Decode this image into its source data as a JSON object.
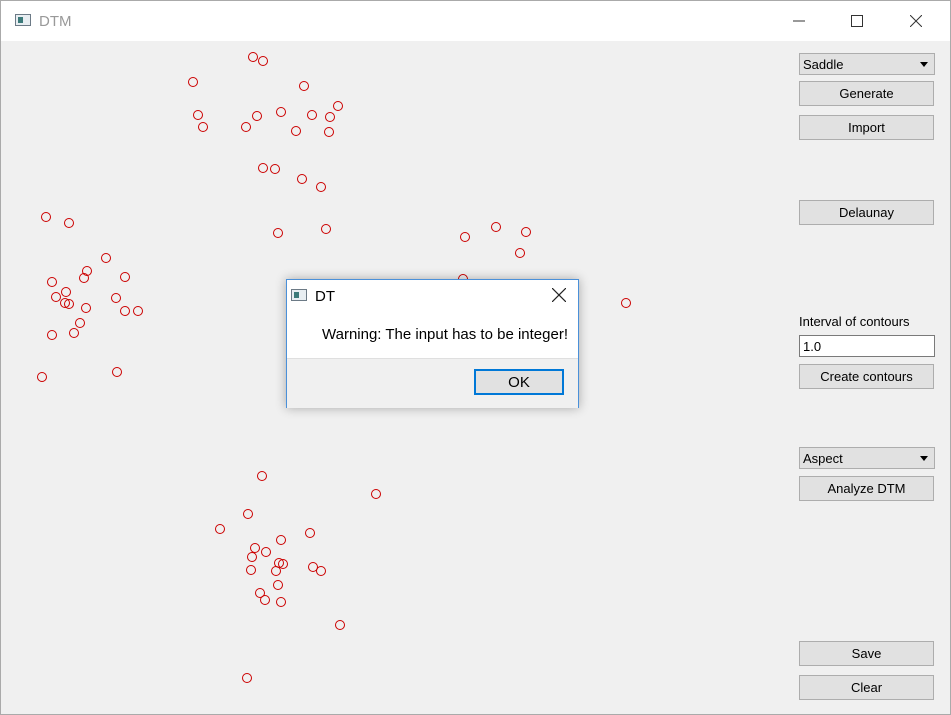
{
  "window": {
    "title": "DTM"
  },
  "controls": {
    "surface_select": "Saddle",
    "generate": "Generate",
    "import": "Import",
    "delaunay": "Delaunay",
    "interval_label": "Interval of contours",
    "interval_value": "1.0",
    "create_contours": "Create contours",
    "analysis_select": "Aspect",
    "analyze": "Analyze DTM",
    "save": "Save",
    "clear": "Clear"
  },
  "dialog": {
    "title": "DT",
    "message": "Warning: The input has to be integer!",
    "ok": "OK"
  },
  "colors": {
    "point_stroke": "#cc0000",
    "dialog_border": "#4a90d9"
  }
}
